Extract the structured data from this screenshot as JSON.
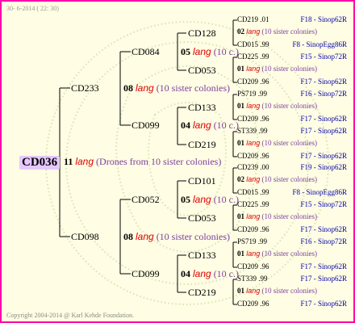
{
  "header": "30- 6-2014 ( 22: 30)",
  "copyright": "Copyright 2004-2014 @ Karl Kehde Foundation.",
  "root": {
    "id": "CD036",
    "num": "11",
    "lang": "lang",
    "note": "(Drones from 10 sister colonies)"
  },
  "sons": [
    {
      "id": "CD233",
      "num": "08",
      "lang": "lang",
      "note": "(10 sister colonies)",
      "gs": [
        {
          "id": "CD084",
          "num": "05",
          "lang": "lang",
          "note": "(10 c.)",
          "kids": [
            {
              "id": "CD128",
              "num": "02",
              "lang": "lang",
              "note": "(10 sister colonies)",
              "top": {
                "id": "CD219",
                "yr": ".01",
                "f": "F18 - Sinop62R"
              },
              "bot": {
                "id": "CD015",
                "yr": ".99",
                "f": "F8 - SinopEgg86R"
              }
            },
            {
              "id": "CD053",
              "num": "01",
              "lang": "lang",
              "note": "(10 sister colonies)",
              "top": {
                "id": "CD225",
                "yr": ".99",
                "f": "F15 - Sinop72R"
              },
              "bot": {
                "id": "CD209",
                "yr": ".96",
                "f": "F17 - Sinop62R"
              }
            }
          ]
        },
        {
          "id": "CD099",
          "num": "04",
          "lang": "lang",
          "note": "(10 c.)",
          "kids": [
            {
              "id": "CD133",
              "num": "01",
              "lang": "lang",
              "note": "(10 sister colonies)",
              "top": {
                "id": "PS719",
                "yr": ".99",
                "f": "F16 - Sinop72R"
              },
              "bot": {
                "id": "CD209",
                "yr": ".96",
                "f": "F17 - Sinop62R"
              }
            },
            {
              "id": "CD219",
              "num": "01",
              "lang": "lang",
              "note": "(10 sister colonies)",
              "top": {
                "id": "ST339",
                "yr": ".99",
                "f": "F17 - Sinop62R"
              },
              "bot": {
                "id": "CD209",
                "yr": ".96",
                "f": "F17 - Sinop62R"
              }
            }
          ]
        }
      ]
    },
    {
      "id": "CD098",
      "num": "08",
      "lang": "lang",
      "note": "(10 sister colonies)",
      "gs": [
        {
          "id": "CD052",
          "num": "05",
          "lang": "lang",
          "note": "(10 c.)",
          "kids": [
            {
              "id": "CD101",
              "num": "02",
              "lang": "lang",
              "note": "(10 sister colonies)",
              "top": {
                "id": "CD239",
                "yr": ".00",
                "f": "F19 - Sinop62R"
              },
              "bot": {
                "id": "CD015",
                "yr": ".99",
                "f": "F8 - SinopEgg86R"
              }
            },
            {
              "id": "CD053",
              "num": "01",
              "lang": "lang",
              "note": "(10 sister colonies)",
              "top": {
                "id": "CD225",
                "yr": ".99",
                "f": "F15 - Sinop72R"
              },
              "bot": {
                "id": "CD209",
                "yr": ".96",
                "f": "F17 - Sinop62R"
              }
            }
          ]
        },
        {
          "id": "CD099",
          "num": "04",
          "lang": "lang",
          "note": "(10 c.)",
          "kids": [
            {
              "id": "CD133",
              "num": "01",
              "lang": "lang",
              "note": "(10 sister colonies)",
              "top": {
                "id": "PS719",
                "yr": ".99",
                "f": "F16 - Sinop72R"
              },
              "bot": {
                "id": "CD209",
                "yr": ".96",
                "f": "F17 - Sinop62R"
              }
            },
            {
              "id": "CD219",
              "num": "01",
              "lang": "lang",
              "note": "(10 sister colonies)",
              "top": {
                "id": "ST339",
                "yr": ".99",
                "f": "F17 - Sinop62R"
              },
              "bot": {
                "id": "CD209",
                "yr": ".96",
                "f": "F17 - Sinop62R"
              }
            }
          ]
        }
      ]
    }
  ]
}
